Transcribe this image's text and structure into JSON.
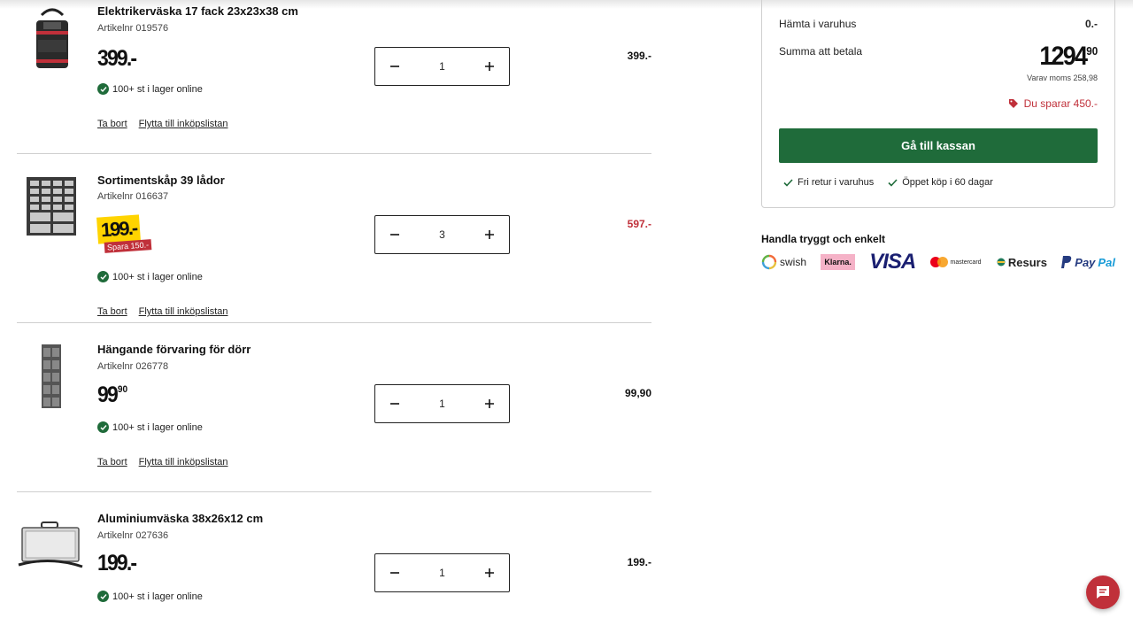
{
  "cart": {
    "items": [
      {
        "name": "Elektrikerväska 17 fack 23x23x38 cm",
        "article": "Artikelnr 019576",
        "price_main": "399.-",
        "price_dec": "",
        "quantity": "1",
        "row_total": "399.-",
        "stock": "100+ st i lager online",
        "remove": "Ta bort",
        "move": "Flytta till inköpslistan"
      },
      {
        "name": "Sortimentskåp 39 lådor",
        "article": "Artikelnr 016637",
        "price_main": "199.-",
        "save_badge": "Spara 150.-",
        "quantity": "3",
        "row_total": "597.-",
        "stock": "100+ st i lager online",
        "remove": "Ta bort",
        "move": "Flytta till inköpslistan"
      },
      {
        "name": "Hängande förvaring för dörr",
        "article": "Artikelnr 026778",
        "price_main": "99",
        "price_dec": "90",
        "quantity": "1",
        "row_total": "99,90",
        "stock": "100+ st i lager online",
        "remove": "Ta bort",
        "move": "Flytta till inköpslistan"
      },
      {
        "name": "Aluminiumväska 38x26x12 cm",
        "article": "Artikelnr 027636",
        "price_main": "199.-",
        "price_dec": "",
        "quantity": "1",
        "row_total": "199.-",
        "stock": "100+ st i lager online"
      }
    ],
    "minus": "−",
    "plus": "+"
  },
  "summary": {
    "pickup_label": "Hämta i varuhus",
    "pickup_value": "0.-",
    "total_label": "Summa att betala",
    "total_main": "1294",
    "total_dec": "90",
    "vat": "Varav moms 258,98",
    "saving": "Du sparar 450.-",
    "checkout": "Gå till kassan",
    "perk1": "Fri retur i varuhus",
    "perk2": "Öppet köp i 60 dagar"
  },
  "payments": {
    "title": "Handla tryggt och enkelt",
    "swish": "swish",
    "klarna": "Klarna.",
    "visa": "VISA",
    "mastercard": "mastercard",
    "resurs": "Resurs",
    "paypal_pay": "Pay",
    "paypal_pal": "Pal"
  },
  "colors": {
    "accent_green": "#1f6b3a",
    "sale_red": "#c0303a",
    "sale_yellow": "#ffd400"
  }
}
